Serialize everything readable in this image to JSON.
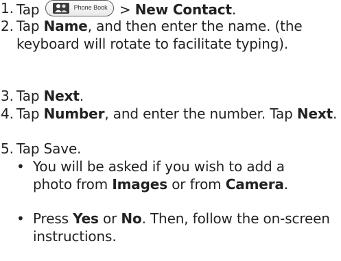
{
  "steps": [
    {
      "number": "1",
      "prefix": "Tap",
      "button_label": "Phone Book",
      "button_icon": "contacts-icon",
      "separator": ">",
      "target": "New Contact",
      "suffix": "."
    },
    {
      "number": "2",
      "text_before": "Tap",
      "bold": "Name",
      "text_after": ", and then enter the name. (the keyboard will rotate to facilitate typing)."
    },
    {
      "number": "3",
      "text_before": "Tap",
      "bold": "Next",
      "text_after": "."
    },
    {
      "number": "4",
      "text_before": "Tap",
      "bold": "Number",
      "text_mid": ", and enter the number. Tap",
      "bold2": "Next",
      "text_after": "."
    },
    {
      "number": "5",
      "text": "Tap Save.",
      "bullets": [
        {
          "marker": "•",
          "text_before": "You will be asked if you wish to add a photo from",
          "bold": "Images",
          "text_mid": "or from",
          "bold2": "Camera",
          "text_after": "."
        },
        {
          "marker": "•",
          "text_before": "Press",
          "bold": "Yes",
          "text_mid": "or",
          "bold2": "No",
          "text_after": ". Then, follow the on-screen instructions."
        }
      ]
    }
  ]
}
